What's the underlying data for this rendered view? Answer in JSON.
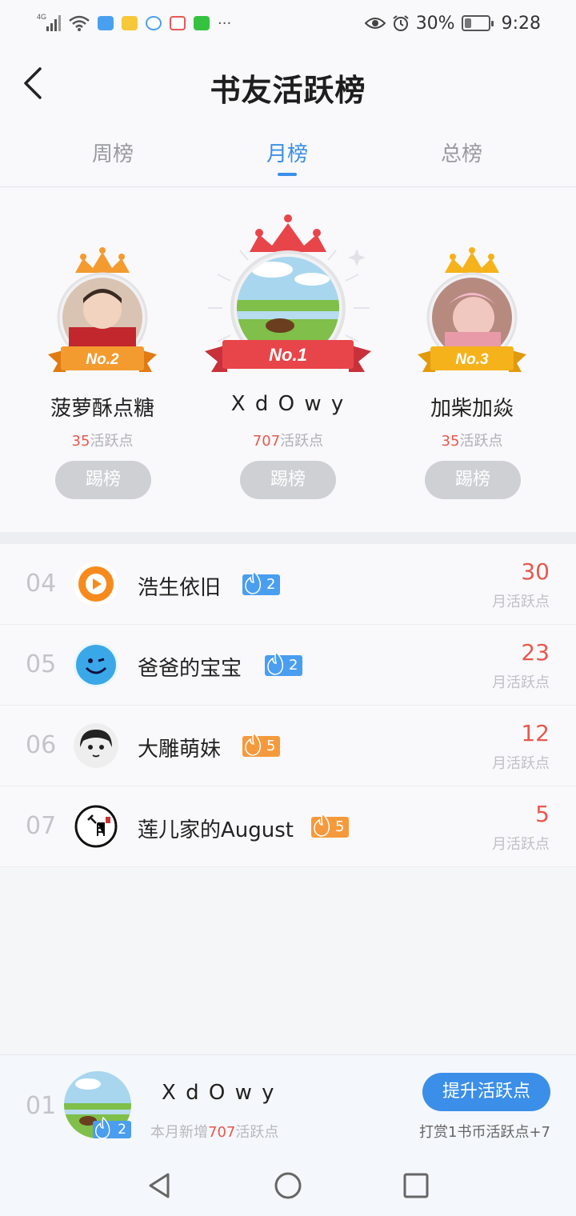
{
  "status_bar": {
    "network": "4G",
    "battery": "30%",
    "battery_level": 0.3,
    "time": "9:28",
    "more": "···"
  },
  "header": {
    "title": "书友活跃榜"
  },
  "tabs": [
    {
      "label": "周榜",
      "active": false
    },
    {
      "label": "月榜",
      "active": true
    },
    {
      "label": "总榜",
      "active": false
    }
  ],
  "podium": {
    "first": {
      "badge": "No.1",
      "name": "X d O w   y",
      "points": "707",
      "points_unit": "活跃点",
      "button": "踢榜"
    },
    "second": {
      "badge": "No.2",
      "name": "菠萝酥点糖",
      "points": "35",
      "points_unit": "活跃点",
      "button": "踢榜"
    },
    "third": {
      "badge": "No.3",
      "name": "加柴加焱",
      "points": "35",
      "points_unit": "活跃点",
      "button": "踢榜"
    }
  },
  "list": [
    {
      "rank": "04",
      "name": "浩生依旧",
      "level": "2",
      "score": "30",
      "score_label": "月活跃点",
      "level_color": "#4a9ef0"
    },
    {
      "rank": "05",
      "name": "爸爸的宝宝",
      "level": "2",
      "score": "23",
      "score_label": "月活跃点",
      "level_color": "#4a9ef0"
    },
    {
      "rank": "06",
      "name": "大雕萌妹",
      "level": "5",
      "score": "12",
      "score_label": "月活跃点",
      "level_color": "#f59a3c"
    },
    {
      "rank": "07",
      "name": "莲儿家的August",
      "level": "5",
      "score": "5",
      "score_label": "月活跃点",
      "level_color": "#f59a3c"
    }
  ],
  "mine": {
    "rank": "01",
    "name": "X d O w   y",
    "level": "2",
    "sub_prefix": "本月新增",
    "sub_points": "707",
    "sub_suffix": "活跃点",
    "button": "提升活跃点",
    "hint": "打赏1书币活跃点+7"
  },
  "colors": {
    "accent": "#3b8fe8",
    "points_red": "#e8584e",
    "gold": "#f5b21a",
    "silver_orange": "#f39b2f",
    "first_red": "#e8454a"
  }
}
